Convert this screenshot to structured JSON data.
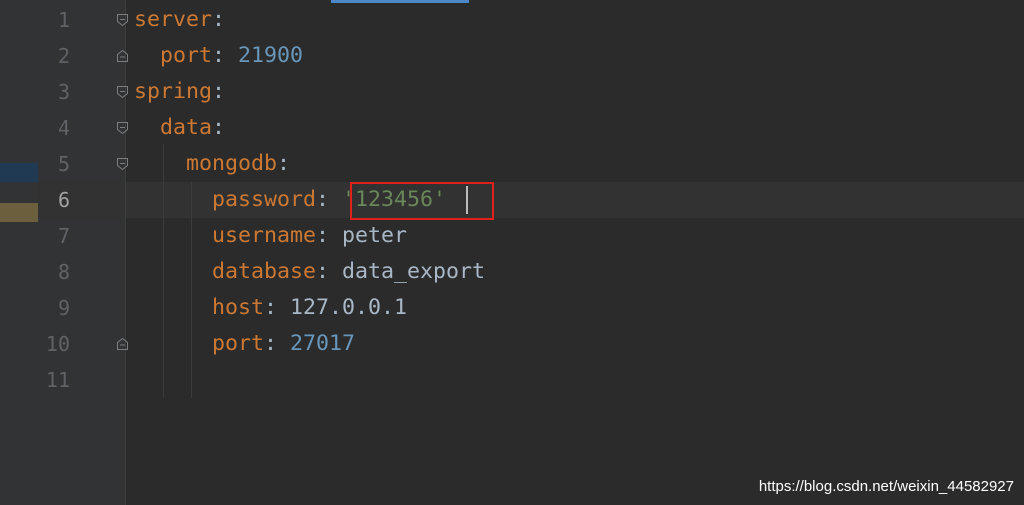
{
  "gutter": {
    "line_numbers": [
      "1",
      "2",
      "3",
      "4",
      "5",
      "6",
      "7",
      "8",
      "9",
      "10",
      "11"
    ],
    "current_line": "6"
  },
  "code": {
    "lines": [
      {
        "indent": "",
        "key": "server",
        "sep": ":",
        "value": "",
        "value_type": ""
      },
      {
        "indent": "  ",
        "key": "port",
        "sep": ": ",
        "value": "21900",
        "value_type": "number"
      },
      {
        "indent": "",
        "key": "spring",
        "sep": ":",
        "value": "",
        "value_type": ""
      },
      {
        "indent": "  ",
        "key": "data",
        "sep": ":",
        "value": "",
        "value_type": ""
      },
      {
        "indent": "    ",
        "key": "mongodb",
        "sep": ":",
        "value": "",
        "value_type": ""
      },
      {
        "indent": "      ",
        "key": "password",
        "sep": ": ",
        "value": "'123456'",
        "value_type": "string"
      },
      {
        "indent": "      ",
        "key": "username",
        "sep": ": ",
        "value": "peter",
        "value_type": "plain"
      },
      {
        "indent": "      ",
        "key": "database",
        "sep": ": ",
        "value": "data_export",
        "value_type": "plain"
      },
      {
        "indent": "      ",
        "key": "host",
        "sep": ": ",
        "value": "127.0.0.1",
        "value_type": "plain"
      },
      {
        "indent": "      ",
        "key": "port",
        "sep": ": ",
        "value": "27017",
        "value_type": "number"
      },
      {
        "indent": "",
        "key": "",
        "sep": "",
        "value": "",
        "value_type": ""
      }
    ]
  },
  "fold_markers": {
    "open_lines": [
      1,
      3,
      4,
      5
    ],
    "close_lines": [
      2,
      10
    ]
  },
  "annotation": {
    "highlight_target": "'123456'",
    "highlight_color": "#e0201b"
  },
  "colors": {
    "background": "#2b2b2b",
    "gutter": "#313335",
    "keyword": "#cc7832",
    "number": "#6897bb",
    "string": "#6a8759",
    "text": "#a9b7c6",
    "line_number": "#606366"
  },
  "watermark": {
    "text": "https://blog.csdn.net/weixin_44582927"
  }
}
